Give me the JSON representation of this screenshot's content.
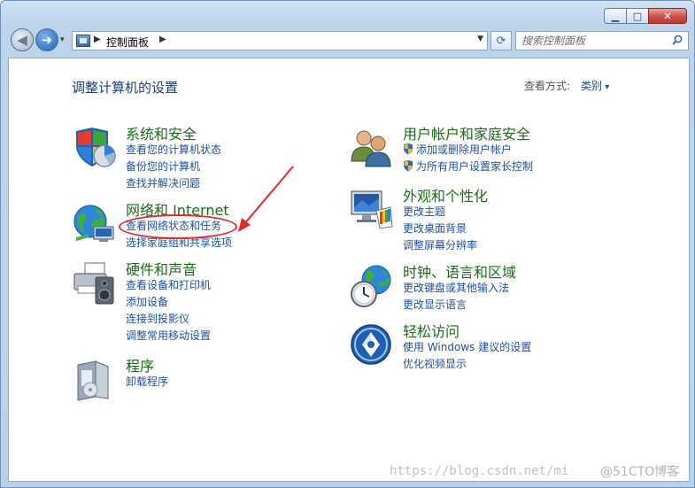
{
  "window": {
    "buttons": {
      "minimize": "▁",
      "maximize": "□",
      "close": "✕"
    }
  },
  "toolbar": {
    "back_glyph": "◀",
    "forward_glyph": "➜",
    "recent_glyph": "▾",
    "address": {
      "path": "控制面板",
      "separator": "▶",
      "dropdown": "▼"
    },
    "refresh_glyph": "⟳",
    "search": {
      "placeholder": "搜索控制面板"
    }
  },
  "main": {
    "title": "调整计算机的设置",
    "view_by_label": "查看方式:",
    "view_by_value": "类别"
  },
  "categories_left": [
    {
      "title": "系统和安全",
      "icon": "shield-pie-icon",
      "links": [
        "查看您的计算机状态",
        "备份您的计算机",
        "查找并解决问题"
      ]
    },
    {
      "title": "网络和 Internet",
      "icon": "globe-network-icon",
      "links": [
        "查看网络状态和任务",
        "选择家庭组和共享选项"
      ]
    },
    {
      "title": "硬件和声音",
      "icon": "printer-speaker-icon",
      "links": [
        "查看设备和打印机",
        "添加设备",
        "连接到投影仪",
        "调整常用移动设置"
      ]
    },
    {
      "title": "程序",
      "icon": "programs-box-icon",
      "links": [
        "卸载程序"
      ]
    }
  ],
  "categories_right": [
    {
      "title": "用户帐户和家庭安全",
      "icon": "users-icon",
      "links": [
        "添加或删除用户帐户",
        "为所有用户设置家长控制"
      ]
    },
    {
      "title": "外观和个性化",
      "icon": "monitor-palette-icon",
      "links": [
        "更改主题",
        "更改桌面背景",
        "调整屏幕分辨率"
      ]
    },
    {
      "title": "时钟、语言和区域",
      "icon": "clock-globe-icon",
      "links": [
        "更改键盘或其他输入法",
        "更改显示语言"
      ]
    },
    {
      "title": "轻松访问",
      "icon": "ease-of-access-icon",
      "links": [
        "使用 Windows 建议的设置",
        "优化视频显示"
      ]
    }
  ],
  "watermark": {
    "url": "https://blog.csdn.net/mi",
    "site": "@51CTO博客"
  },
  "colors": {
    "category_title": "#1b6b1b",
    "link": "#1e4fa8",
    "title": "#1f3d73",
    "highlight": "#e3282d"
  }
}
